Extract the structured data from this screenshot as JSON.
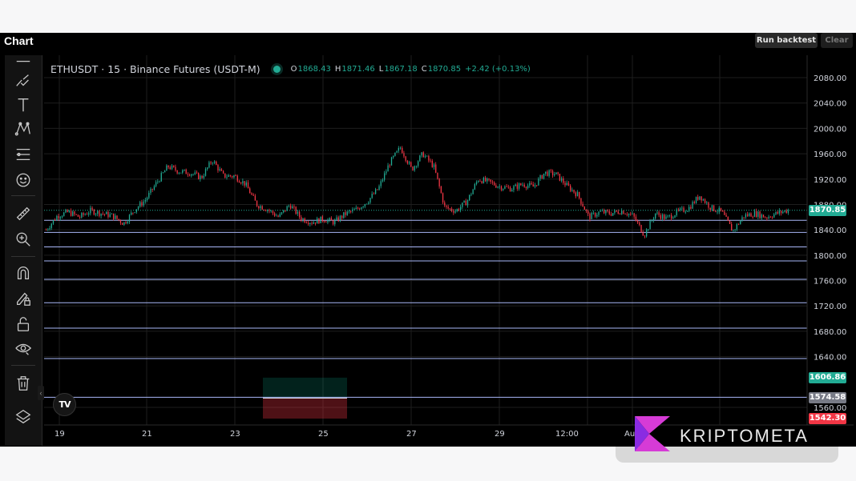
{
  "header": {
    "title": "Chart",
    "run_backtest": "Run backtest",
    "clear": "Clear"
  },
  "legend": {
    "symbol": "ETHUSDT · 15 · Binance Futures (USDT-M)",
    "o_label": "O",
    "o": "1868.43",
    "h_label": "H",
    "h": "1871.46",
    "l_label": "L",
    "l": "1867.18",
    "c_label": "C",
    "c": "1870.85",
    "change": "+2.42 (+0.13%)"
  },
  "toolbar": {
    "icons": [
      "crosshair-line-icon",
      "trend-line-icon",
      "text-icon",
      "pattern-icon",
      "fib-icon",
      "emoji-icon",
      "ruler-icon",
      "zoom-in-icon",
      "magnet-icon",
      "lock-draw-icon",
      "unlock-icon",
      "eye-icon",
      "trash-icon",
      "layers-icon"
    ]
  },
  "colors": {
    "up": "#22ab94",
    "down": "#f23645",
    "line": "#a9b7f8",
    "grid": "#1e1e1e",
    "bg": "#000000"
  },
  "logo": {
    "text": "TV"
  },
  "watermark": {
    "text": "KRIPTOMETA"
  },
  "chart_data": {
    "type": "candlestick",
    "symbol": "ETHUSDT",
    "interval": "15",
    "ylim": [
      1525,
      2110
    ],
    "y_ticks": [
      2080,
      2040,
      2000,
      1960,
      1920,
      1880,
      1840,
      1800,
      1760,
      1720,
      1680,
      1640,
      1560
    ],
    "y_tick_labels": [
      "2080.00",
      "2040.00",
      "2000.00",
      "1960.00",
      "1920.00",
      "1880.00",
      "1840.00",
      "1800.00",
      "1760.00",
      "1720.00",
      "1680.00",
      "1640.00",
      "1560.00"
    ],
    "x_ticks": [
      "19",
      "21",
      "23",
      "25",
      "27",
      "29",
      "12:00",
      "Aug"
    ],
    "price_badges": [
      {
        "label": "1870.85",
        "value": 1870.85,
        "color": "#22ab94"
      },
      {
        "label": "1606.86",
        "value": 1606.86,
        "color": "#22ab94"
      },
      {
        "label": "1574.58",
        "value": 1574.58,
        "color": "#787b86"
      },
      {
        "label": "1542.30",
        "value": 1542.3,
        "color": "#f23645"
      }
    ],
    "horizontal_lines": [
      1855,
      1836,
      1813,
      1791,
      1762,
      1725,
      1685,
      1637,
      1576
    ],
    "position_box": {
      "entry": 1574.58,
      "take_profit": 1606.86,
      "stop_loss": 1542.3
    },
    "price_path": [
      [
        0,
        1840
      ],
      [
        1,
        1862
      ],
      [
        2,
        1868
      ],
      [
        3,
        1860
      ],
      [
        4,
        1870
      ],
      [
        5,
        1866
      ],
      [
        6,
        1862
      ],
      [
        7,
        1850
      ],
      [
        8,
        1872
      ],
      [
        9,
        1888
      ],
      [
        10,
        1915
      ],
      [
        11,
        1940
      ],
      [
        12,
        1932
      ],
      [
        13,
        1930
      ],
      [
        14,
        1922
      ],
      [
        15,
        1950
      ],
      [
        16,
        1925
      ],
      [
        17,
        1925
      ],
      [
        18,
        1912
      ],
      [
        19,
        1880
      ],
      [
        20,
        1872
      ],
      [
        21,
        1860
      ],
      [
        22,
        1880
      ],
      [
        23,
        1858
      ],
      [
        24,
        1852
      ],
      [
        25,
        1857
      ],
      [
        26,
        1852
      ],
      [
        27,
        1865
      ],
      [
        28,
        1872
      ],
      [
        29,
        1885
      ],
      [
        30,
        1905
      ],
      [
        31,
        1945
      ],
      [
        32,
        1970
      ],
      [
        33,
        1935
      ],
      [
        34,
        1960
      ],
      [
        35,
        1940
      ],
      [
        36,
        1875
      ],
      [
        37,
        1870
      ],
      [
        38,
        1885
      ],
      [
        39,
        1920
      ],
      [
        40,
        1915
      ],
      [
        41,
        1908
      ],
      [
        42,
        1905
      ],
      [
        43,
        1912
      ],
      [
        44,
        1908
      ],
      [
        45,
        1930
      ],
      [
        46,
        1928
      ],
      [
        47,
        1910
      ],
      [
        48,
        1895
      ],
      [
        49,
        1860
      ],
      [
        50,
        1868
      ],
      [
        51,
        1866
      ],
      [
        52,
        1870
      ],
      [
        53,
        1862
      ],
      [
        54,
        1832
      ],
      [
        55,
        1866
      ],
      [
        56,
        1858
      ],
      [
        57,
        1868
      ],
      [
        58,
        1874
      ],
      [
        59,
        1894
      ],
      [
        60,
        1875
      ],
      [
        61,
        1868
      ],
      [
        62,
        1838
      ],
      [
        63,
        1862
      ],
      [
        64,
        1866
      ],
      [
        65,
        1860
      ],
      [
        66,
        1866
      ],
      [
        67,
        1871
      ]
    ]
  }
}
